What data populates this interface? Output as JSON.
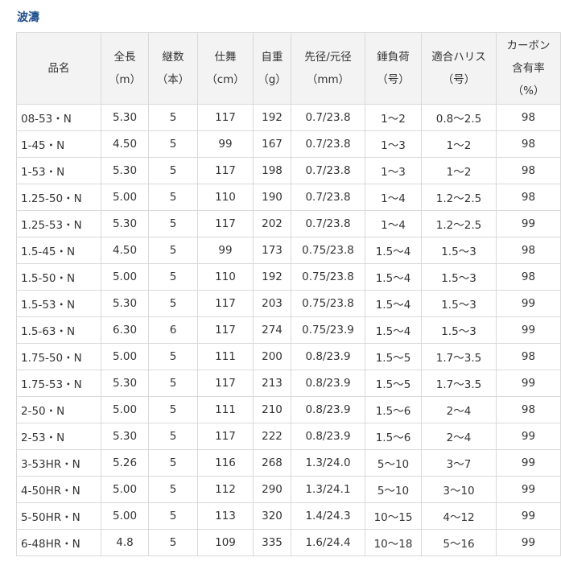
{
  "title": "波濤",
  "headers": [
    [
      "品名"
    ],
    [
      "全長",
      "（m）"
    ],
    [
      "継数",
      "（本）"
    ],
    [
      "仕舞",
      "（cm）"
    ],
    [
      "自重",
      "（g）"
    ],
    [
      "先径/元径",
      "（mm）"
    ],
    [
      "錘負荷",
      "（号）"
    ],
    [
      "適合ハリス",
      "（号）"
    ],
    [
      "カーボン",
      "含有率",
      "（%）"
    ]
  ],
  "rows": [
    [
      "08-53・N",
      "5.30",
      "5",
      "117",
      "192",
      "0.7/23.8",
      "1〜2",
      "0.8〜2.5",
      "98"
    ],
    [
      "1-45・N",
      "4.50",
      "5",
      "99",
      "167",
      "0.7/23.8",
      "1〜3",
      "1〜2",
      "98"
    ],
    [
      "1-53・N",
      "5.30",
      "5",
      "117",
      "198",
      "0.7/23.8",
      "1〜3",
      "1〜2",
      "98"
    ],
    [
      "1.25-50・N",
      "5.00",
      "5",
      "110",
      "190",
      "0.7/23.8",
      "1〜4",
      "1.2〜2.5",
      "98"
    ],
    [
      "1.25-53・N",
      "5.30",
      "5",
      "117",
      "202",
      "0.7/23.8",
      "1〜4",
      "1.2〜2.5",
      "99"
    ],
    [
      "1.5-45・N",
      "4.50",
      "5",
      "99",
      "173",
      "0.75/23.8",
      "1.5〜4",
      "1.5〜3",
      "98"
    ],
    [
      "1.5-50・N",
      "5.00",
      "5",
      "110",
      "192",
      "0.75/23.8",
      "1.5〜4",
      "1.5〜3",
      "98"
    ],
    [
      "1.5-53・N",
      "5.30",
      "5",
      "117",
      "203",
      "0.75/23.8",
      "1.5〜4",
      "1.5〜3",
      "99"
    ],
    [
      "1.5-63・N",
      "6.30",
      "6",
      "117",
      "274",
      "0.75/23.9",
      "1.5〜4",
      "1.5〜3",
      "99"
    ],
    [
      "1.75-50・N",
      "5.00",
      "5",
      "111",
      "200",
      "0.8/23.9",
      "1.5〜5",
      "1.7〜3.5",
      "98"
    ],
    [
      "1.75-53・N",
      "5.30",
      "5",
      "117",
      "213",
      "0.8/23.9",
      "1.5〜5",
      "1.7〜3.5",
      "99"
    ],
    [
      "2-50・N",
      "5.00",
      "5",
      "111",
      "210",
      "0.8/23.9",
      "1.5〜6",
      "2〜4",
      "98"
    ],
    [
      "2-53・N",
      "5.30",
      "5",
      "117",
      "222",
      "0.8/23.9",
      "1.5〜6",
      "2〜4",
      "99"
    ],
    [
      "3-53HR・N",
      "5.26",
      "5",
      "116",
      "268",
      "1.3/24.0",
      "5〜10",
      "3〜7",
      "99"
    ],
    [
      "4-50HR・N",
      "5.00",
      "5",
      "112",
      "290",
      "1.3/24.1",
      "5〜10",
      "3〜10",
      "99"
    ],
    [
      "5-50HR・N",
      "5.00",
      "5",
      "113",
      "320",
      "1.4/24.3",
      "10〜15",
      "4〜12",
      "99"
    ],
    [
      "6-48HR・N",
      "4.8",
      "5",
      "109",
      "335",
      "1.6/24.4",
      "10〜18",
      "5〜16",
      "99"
    ]
  ]
}
